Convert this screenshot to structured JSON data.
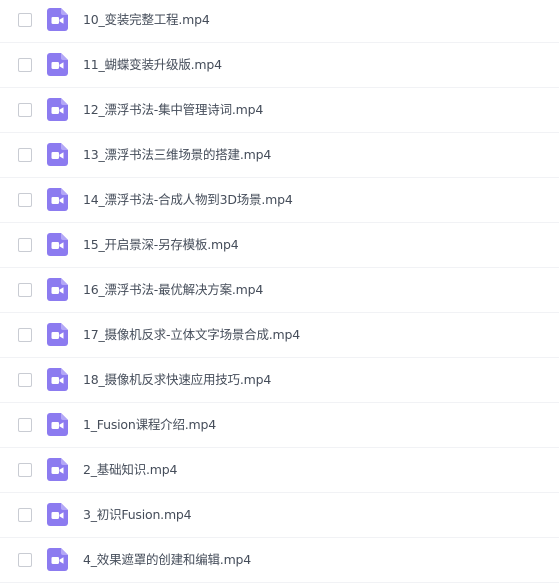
{
  "colors": {
    "icon_purple": "#8c7bf0",
    "text": "#454d5a",
    "divider": "#f1f2f5",
    "checkbox_border": "#c9ccd3"
  },
  "icon": "video-file-icon",
  "files": [
    {
      "name": "10_变装完整工程.mp4"
    },
    {
      "name": "11_蝴蝶变装升级版.mp4"
    },
    {
      "name": "12_漂浮书法-集中管理诗词.mp4"
    },
    {
      "name": "13_漂浮书法三维场景的搭建.mp4"
    },
    {
      "name": "14_漂浮书法-合成人物到3D场景.mp4"
    },
    {
      "name": "15_开启景深-另存模板.mp4"
    },
    {
      "name": "16_漂浮书法-最优解决方案.mp4"
    },
    {
      "name": "17_摄像机反求-立体文字场景合成.mp4"
    },
    {
      "name": "18_摄像机反求快速应用技巧.mp4"
    },
    {
      "name": "1_Fusion课程介绍.mp4"
    },
    {
      "name": "2_基础知识.mp4"
    },
    {
      "name": "3_初识Fusion.mp4"
    },
    {
      "name": "4_效果遮罩的创建和编辑.mp4"
    }
  ]
}
